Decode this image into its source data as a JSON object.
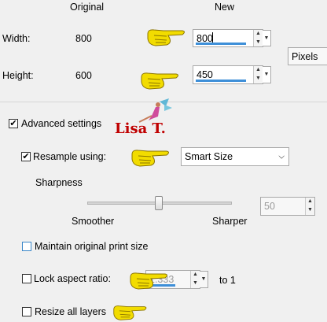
{
  "headers": {
    "original": "Original",
    "new": "New"
  },
  "width": {
    "label": "Width:",
    "original": "800",
    "value": "800"
  },
  "height": {
    "label": "Height:",
    "original": "600",
    "value": "450"
  },
  "units": {
    "selected": "Pixels"
  },
  "advanced": {
    "label": "Advanced settings",
    "checked": true
  },
  "resample": {
    "label": "Resample using:",
    "checked": true,
    "selected": "Smart Size"
  },
  "sharpness": {
    "label": "Sharpness",
    "smoother": "Smoother",
    "sharper": "Sharper",
    "value": "50"
  },
  "maintain_print": {
    "label": "Maintain original print size",
    "checked": false
  },
  "lock_aspect": {
    "label": "Lock aspect ratio:",
    "value": "1.333",
    "to_label": "to 1",
    "checked": false
  },
  "resize_layers": {
    "label": "Resize all layers",
    "checked": false
  },
  "watermark": {
    "text": "Lisa T."
  },
  "colors": {
    "accent": "#3e8fd8",
    "hand": "#f2dc00",
    "watermark": "#c00000"
  }
}
